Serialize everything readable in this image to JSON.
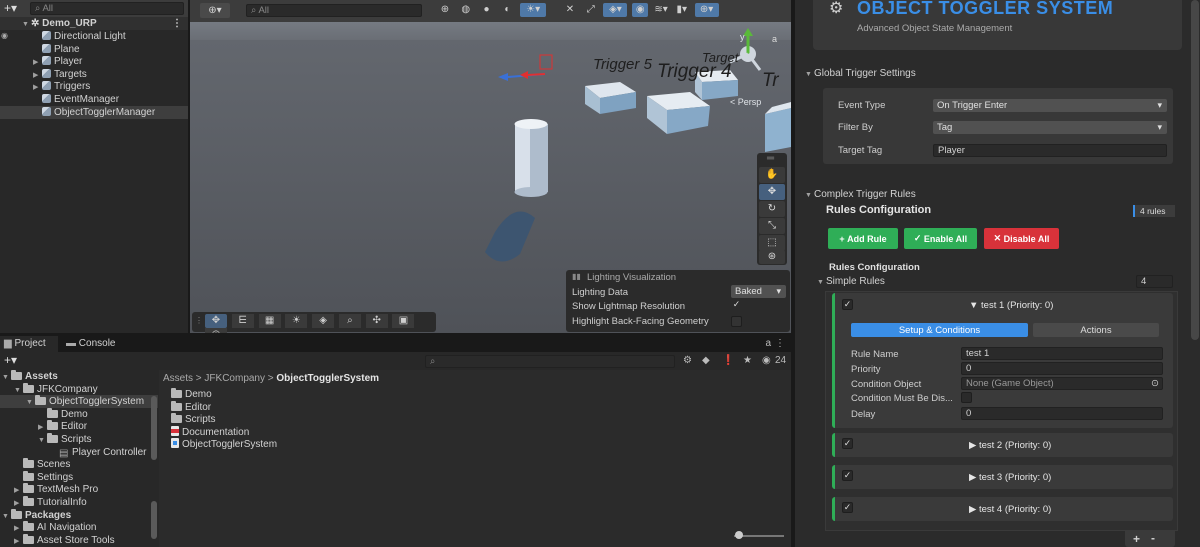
{
  "hierarchy": {
    "search_placeholder": "All",
    "scene": "Demo_URP",
    "items": [
      "Directional Light",
      "Plane",
      "Player",
      "Targets",
      "Triggers",
      "EventManager",
      "ObjectTogglerManager"
    ]
  },
  "scene_view": {
    "search_placeholder": "All",
    "labels": [
      "Trigger 5",
      "Trigger 4",
      "Target",
      "Tr"
    ],
    "persp": "< Persp",
    "lighting": {
      "title": "Lighting Visualization",
      "lighting_data_label": "Lighting Data",
      "lighting_data_value": "Baked",
      "lightmap_label": "Show Lightmap Resolution",
      "backface_label": "Highlight Back-Facing Geometry"
    }
  },
  "bottom": {
    "tabs": [
      "Project",
      "Console"
    ],
    "favorites_count": "24",
    "breadcrumb": [
      "Assets",
      "JFKCompany",
      "ObjectTogglerSystem"
    ],
    "tree": [
      "Assets",
      "JFKCompany",
      "ObjectTogglerSystem",
      "Demo",
      "Editor",
      "Scripts",
      "Player Controller",
      "Scenes",
      "Settings",
      "TextMesh Pro",
      "TutorialInfo",
      "Packages",
      "AI Navigation",
      "Asset Store Tools"
    ],
    "files": [
      "Demo",
      "Editor",
      "Scripts",
      "Documentation",
      "ObjectTogglerSystem"
    ]
  },
  "inspector": {
    "title": "OBJECT TOGGLER SYSTEM",
    "subtitle": "Advanced Object State Management",
    "global_header": "Global Trigger Settings",
    "event_type_label": "Event Type",
    "event_type_value": "On Trigger Enter",
    "filter_by_label": "Filter By",
    "filter_by_value": "Tag",
    "target_tag_label": "Target Tag",
    "target_tag_value": "Player",
    "complex_header": "Complex Trigger Rules",
    "rules_config": "Rules Configuration",
    "rules_count": "4 rules",
    "add_rule": "Add Rule",
    "enable_all": "Enable All",
    "disable_all": "Disable All",
    "rules_config2": "Rules Configuration",
    "simple_rules": "Simple Rules",
    "simple_rules_count": "4",
    "rule1": {
      "title": "▼ test 1 (Priority: 0)",
      "tab_setup": "Setup & Conditions",
      "tab_actions": "Actions",
      "name_label": "Rule Name",
      "name_value": "test 1",
      "priority_label": "Priority",
      "priority_value": "0",
      "cond_obj_label": "Condition Object",
      "cond_obj_value": "None (Game Object)",
      "cond_dis_label": "Condition Must Be Dis...",
      "delay_label": "Delay",
      "delay_value": "0"
    },
    "rule2": "▶ test 2 (Priority: 0)",
    "rule3": "▶ test 3 (Priority: 0)",
    "rule4": "▶ test 4 (Priority: 0)",
    "footer_plus": "+",
    "footer_minus": "-"
  },
  "colors": {
    "accent_blue": "#3a8ee6",
    "green": "#2fae57",
    "red": "#d8323a",
    "selection": "#2c5d87"
  }
}
